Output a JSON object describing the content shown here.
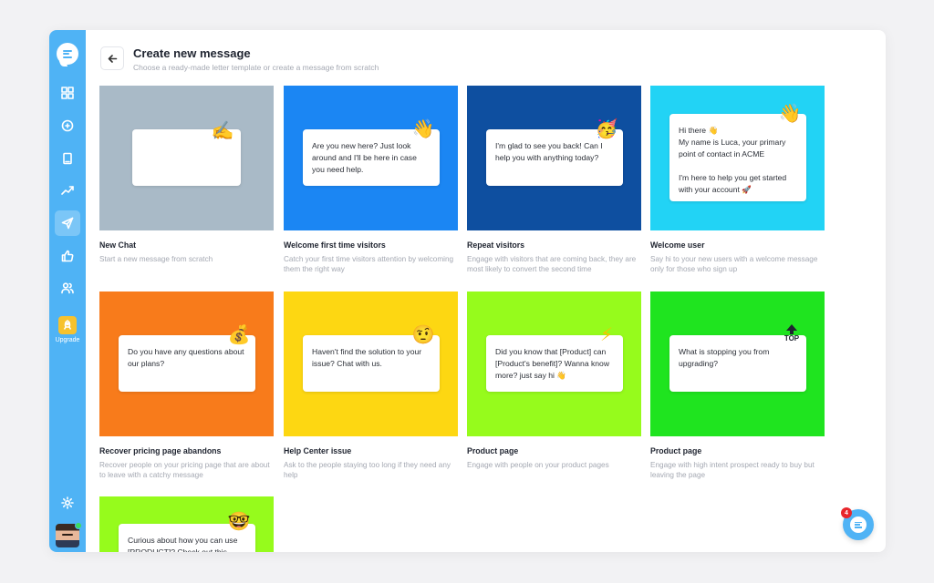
{
  "header": {
    "title": "Create new message",
    "subtitle": "Choose a ready-made letter template or create a message from scratch"
  },
  "sidebar": {
    "upgrade_label": "Upgrade",
    "items": [
      {
        "icon": "grid-icon"
      },
      {
        "icon": "chat-bubble-icon"
      },
      {
        "icon": "book-icon"
      },
      {
        "icon": "trend-up-icon"
      },
      {
        "icon": "send-icon",
        "active": true
      },
      {
        "icon": "thumbs-up-icon"
      },
      {
        "icon": "users-icon"
      },
      {
        "icon": "rocket-icon"
      },
      {
        "icon": "gear-icon"
      }
    ]
  },
  "templates": [
    {
      "title": "New Chat",
      "description": "Start a new message from scratch",
      "bubble": "",
      "color": "#a9bac7",
      "decor": "✍️"
    },
    {
      "title": "Welcome first time visitors",
      "description": "Catch your first time visitors attention by welcoming them the right way",
      "bubble": "Are you new here? Just look around and I'll be here in case you need help.",
      "color": "#1b86f3",
      "decor": "👋"
    },
    {
      "title": "Repeat visitors",
      "description": "Engage with visitors that are coming back, they are most likely to convert the second time",
      "bubble": "I'm glad to see you back! Can I help you with anything today?",
      "color": "#0e4fa0",
      "decor": "🥳"
    },
    {
      "title": "Welcome user",
      "description": "Say hi to your new users with a welcome message only for those who sign up",
      "bubble": "Hi there 👋\nMy name is Luca, your primary point of contact in ACME\n\nI'm here to help you get started with your account 🚀",
      "color": "#22d3f5",
      "decor": "👋"
    },
    {
      "title": "Recover pricing page abandons",
      "description": "Recover people on your pricing page that are about to leave with a catchy message",
      "bubble": "Do you have any questions about our plans?",
      "color": "#f87b1b",
      "decor": "💰"
    },
    {
      "title": "Help Center issue",
      "description": "Ask to the people staying too long if they need any help",
      "bubble": "Haven't find the solution to your issue? Chat with us.",
      "color": "#fdd712",
      "decor": "🤨"
    },
    {
      "title": "Product page",
      "description": "Engage with people on your product pages",
      "bubble": "Did you know that [Product] can [Product's benefit]? Wanna know more? just say hi 👋",
      "color": "#96fb1c",
      "decor": "⚡"
    },
    {
      "title": "Product page",
      "description": "Engage with high intent prospect ready to buy but leaving the page",
      "bubble": "What is stopping you from upgrading?",
      "color": "#1fe41f",
      "decor": "TOP"
    },
    {
      "title": "",
      "description": "",
      "bubble": "Curious about how you can use [PRODUCT]? Check out this",
      "color": "#96fb1c",
      "decor": "🤓"
    }
  ],
  "chat_widget": {
    "badge_count": "4"
  }
}
